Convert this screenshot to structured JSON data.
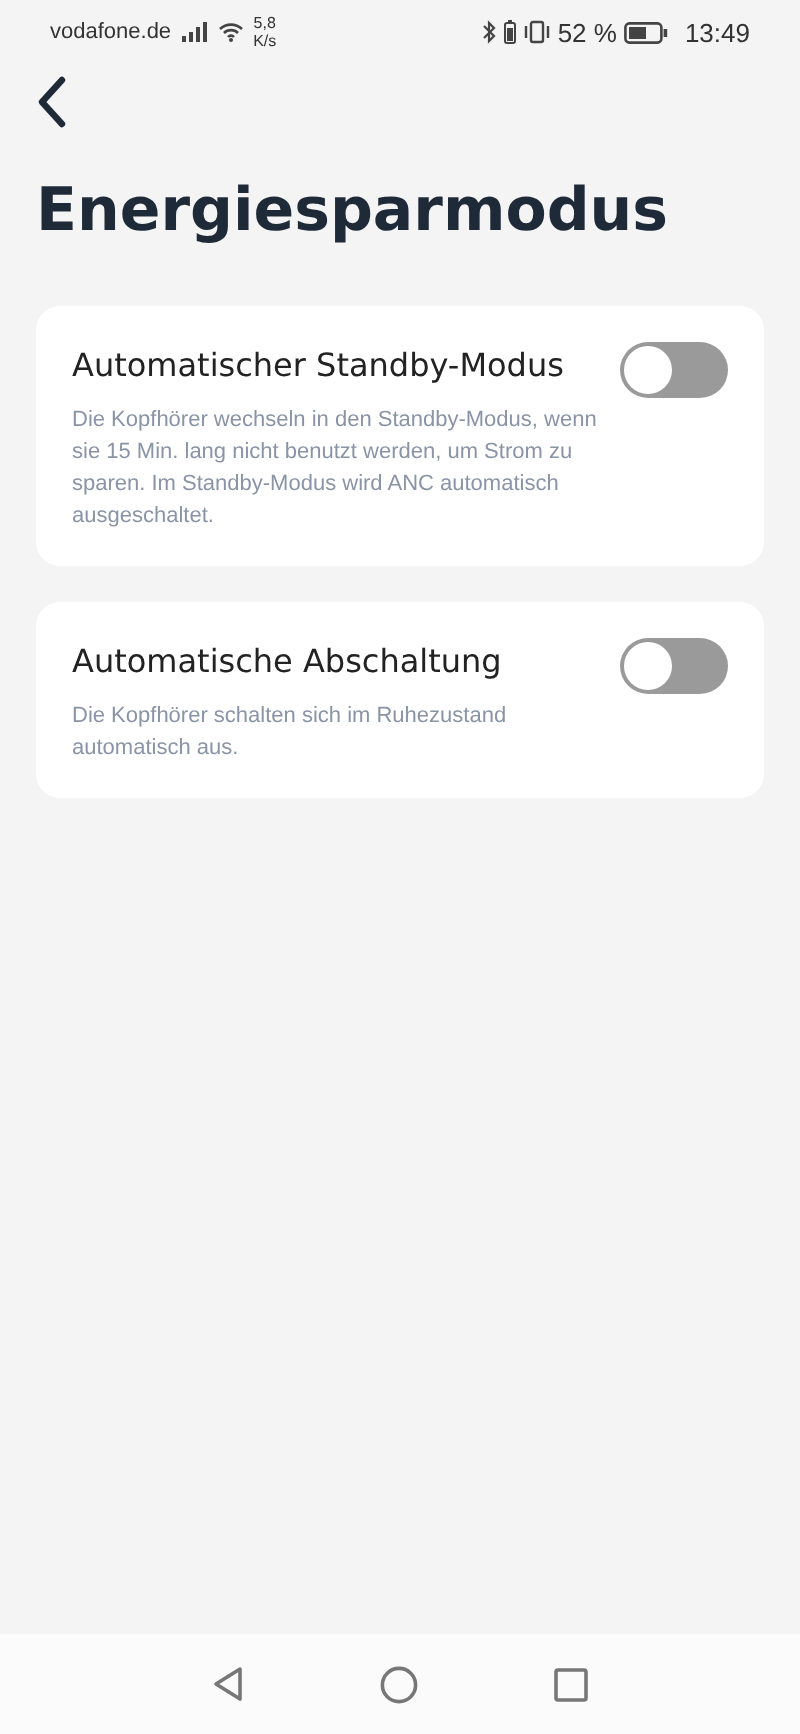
{
  "status_bar": {
    "carrier": "vodafone.de",
    "speed_value": "5,8",
    "speed_unit": "K/s",
    "battery_percent": "52 %",
    "time": "13:49"
  },
  "title": "Energiesparmodus",
  "settings": [
    {
      "title": "Automatischer Standby-Modus",
      "description": "Die Kopfhörer wechseln in den Standby-Modus, wenn sie 15 Min. lang nicht benutzt werden, um Strom zu sparen. Im Standby-Modus wird ANC automatisch ausgeschaltet.",
      "on": false
    },
    {
      "title": "Automatische Abschaltung",
      "description": "Die Kopfhörer schalten sich im Ruhezustand automatisch aus.",
      "on": false
    }
  ]
}
